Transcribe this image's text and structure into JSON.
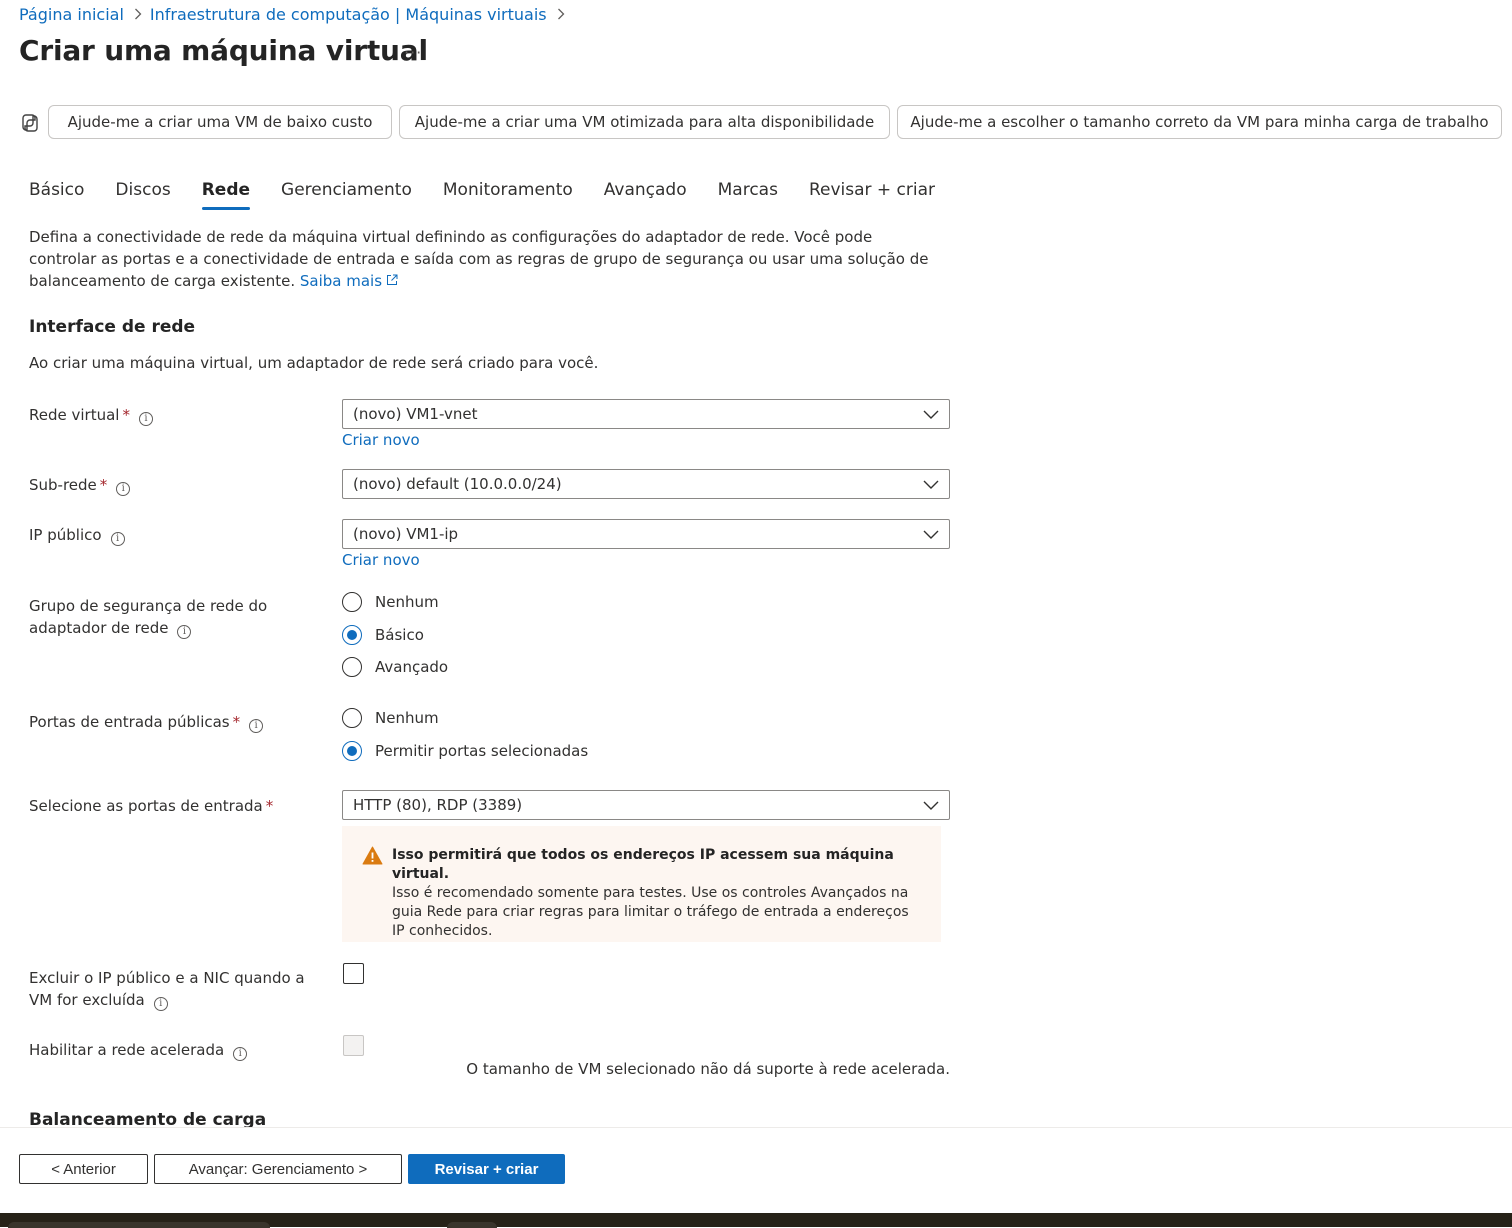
{
  "breadcrumb": {
    "items": [
      "Página inicial",
      "Infraestrutura de computação | Máquinas virtuais"
    ]
  },
  "page": {
    "title": "Criar uma máquina virtual",
    "more": "···"
  },
  "copilot": {
    "suggestions": [
      "Ajude-me a criar uma VM de baixo custo",
      "Ajude-me a criar uma VM otimizada para alta disponibilidade",
      "Ajude-me a escolher o tamanho correto da VM para minha carga de trabalho"
    ]
  },
  "tabs": [
    {
      "label": "Básico",
      "active": false
    },
    {
      "label": "Discos",
      "active": false
    },
    {
      "label": "Rede",
      "active": true
    },
    {
      "label": "Gerenciamento",
      "active": false
    },
    {
      "label": "Monitoramento",
      "active": false
    },
    {
      "label": "Avançado",
      "active": false
    },
    {
      "label": "Marcas",
      "active": false
    },
    {
      "label": "Revisar + criar",
      "active": false
    }
  ],
  "description": {
    "text": "Defina a conectividade de rede da máquina virtual definindo as configurações do adaptador de rede. Você pode controlar as portas e a conectividade de entrada e saída com as regras de grupo de segurança ou usar uma solução de balanceamento de carga existente.",
    "learn_more": "Saiba mais"
  },
  "network_interface": {
    "title": "Interface de rede",
    "intro": "Ao criar uma máquina virtual, um adaptador de rede será criado para você.",
    "virtual_network": {
      "label": "Rede virtual",
      "required": "*",
      "value": "(novo) VM1-vnet",
      "create_new": "Criar novo"
    },
    "subnet": {
      "label": "Sub-rede",
      "required": "*",
      "value": "(novo) default (10.0.0.0/24)"
    },
    "public_ip": {
      "label": "IP público",
      "value": "(novo) VM1-ip",
      "create_new": "Criar novo"
    },
    "nsg": {
      "label": "Grupo de segurança de rede do adaptador de rede",
      "options": [
        "Nenhum",
        "Básico",
        "Avançado"
      ],
      "selected": "Básico"
    },
    "public_inbound_ports": {
      "label": "Portas de entrada públicas",
      "required": "*",
      "options": [
        "Nenhum",
        "Permitir portas selecionadas"
      ],
      "selected": "Permitir portas selecionadas"
    },
    "inbound_ports": {
      "label": "Selecione as portas de entrada",
      "required": "*",
      "value": "HTTP (80), RDP (3389)"
    },
    "warning": {
      "title": "Isso permitirá que todos os endereços IP acessem sua máquina virtual.",
      "body": "Isso é recomendado somente para testes.  Use os controles Avançados na guia Rede para criar regras para limitar o tráfego de entrada a endereços IP conhecidos."
    },
    "delete_ip_nic": {
      "label": "Excluir o IP público e a NIC quando a VM for excluída",
      "checked": false
    },
    "accelerated": {
      "label": "Habilitar a rede acelerada",
      "checked": false,
      "disabled": true,
      "note": "O tamanho de VM selecionado não dá suporte à rede acelerada."
    }
  },
  "load_balancing": {
    "title": "Balanceamento de carga"
  },
  "footer": {
    "previous": "< Anterior",
    "next": "Avançar: Gerenciamento >",
    "review": "Revisar + criar"
  },
  "colors": {
    "accent": "#0f6cbd",
    "required": "#a4262c",
    "warning_bg": "#fdf6f1",
    "warning_icon": "#da7b11"
  },
  "icons": {
    "info": "info-icon",
    "chevron": "chevron-down-icon",
    "warning": "warning-icon",
    "external": "external-link-icon",
    "copilot": "copilot-icon"
  }
}
